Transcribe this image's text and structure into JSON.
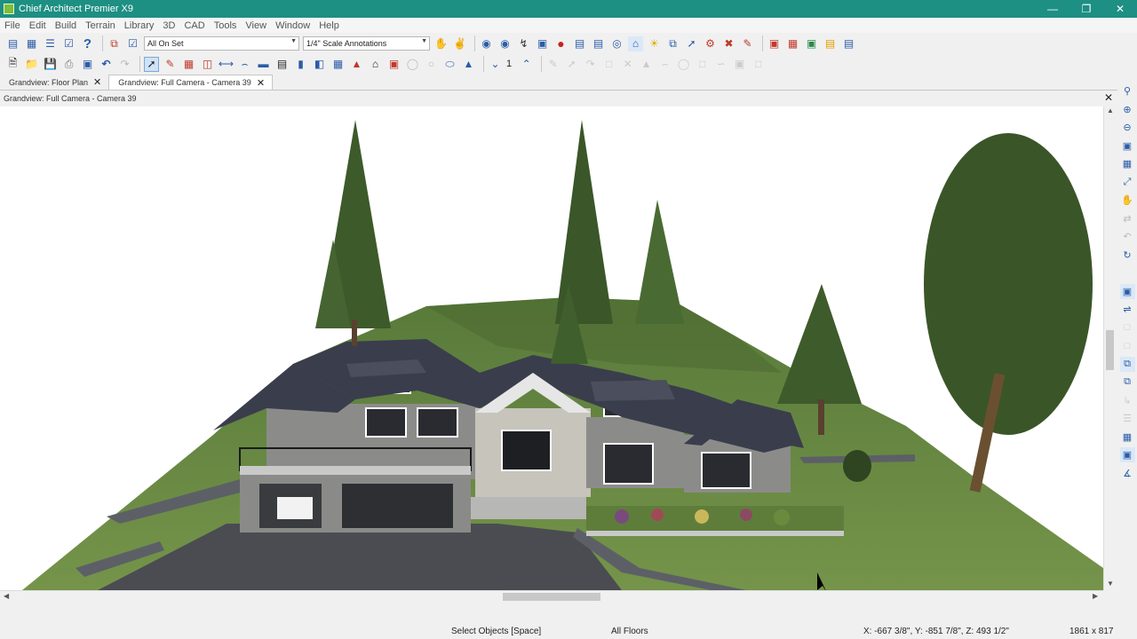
{
  "window": {
    "title": "Chief Architect Premier X9"
  },
  "menu": [
    "File",
    "Edit",
    "Build",
    "Terrain",
    "Library",
    "3D",
    "CAD",
    "Tools",
    "View",
    "Window",
    "Help"
  ],
  "toolbar": {
    "layer_set": "All On Set",
    "annotation_set": "1/4\" Scale Annotations",
    "floor_number": "1"
  },
  "tabs": [
    {
      "label": "Grandview: Floor Plan"
    },
    {
      "label": "Grandview: Full Camera - Camera 39"
    }
  ],
  "view": {
    "header": "Grandview: Full Camera - Camera 39"
  },
  "status": {
    "mode": "Select Objects [Space]",
    "floors": "All Floors",
    "coords": "X: -667 3/8\", Y: -851 7/8\", Z: 493 1/2\"",
    "size": "1861 x 817"
  },
  "colors": {
    "titlebar": "#1e8f83",
    "grass": "#6d8c45",
    "roof": "#3a3d4c",
    "siding": "#8a8a88"
  }
}
